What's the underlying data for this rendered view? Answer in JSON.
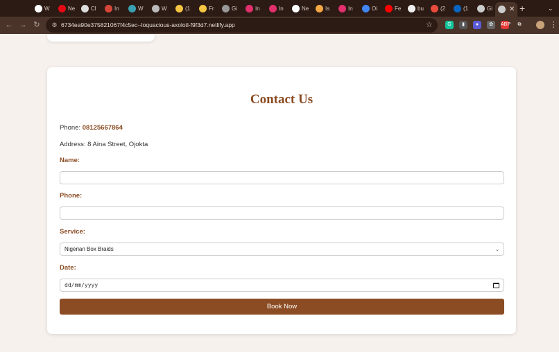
{
  "browser": {
    "tabs": [
      {
        "title": "W",
        "color": "#ffffff"
      },
      {
        "title": "Ne",
        "color": "#e50914"
      },
      {
        "title": "Cl",
        "color": "#dddddd"
      },
      {
        "title": "In",
        "color": "#d44638"
      },
      {
        "title": "W",
        "color": "#3aa0b3"
      },
      {
        "title": "W",
        "color": "#bbbbbb"
      },
      {
        "title": "(1",
        "color": "#f4c542"
      },
      {
        "title": "Fr",
        "color": "#f4c542"
      },
      {
        "title": "Gi",
        "color": "#999999"
      },
      {
        "title": "In",
        "color": "#e1306c"
      },
      {
        "title": "In",
        "color": "#e1306c"
      },
      {
        "title": "Ne",
        "color": "#ffffff"
      },
      {
        "title": "Is",
        "color": "#f4a742"
      },
      {
        "title": "In",
        "color": "#e1306c"
      },
      {
        "title": "Oi",
        "color": "#4285f4"
      },
      {
        "title": "Fe",
        "color": "#ff0000"
      },
      {
        "title": "bu",
        "color": "#eeeeee"
      },
      {
        "title": "(2",
        "color": "#e94c3c"
      },
      {
        "title": "(1",
        "color": "#0a66c2"
      },
      {
        "title": "Gi",
        "color": "#cccccc"
      }
    ],
    "active_tab_color": "#cccccc",
    "url": "6734ea90e375821067f4c5ec--loquacious-axolotl-f9f3d7.netlify.app",
    "extensions": [
      {
        "label": "G",
        "color": "#15c39a"
      },
      {
        "label": "▮",
        "color": "#555555"
      },
      {
        "label": "●",
        "color": "#5b5bd6"
      },
      {
        "label": "✿",
        "color": "#666666"
      },
      {
        "label": "ABP",
        "color": "#e53935"
      },
      {
        "label": "⧉",
        "color": "#4a342a"
      }
    ]
  },
  "contact": {
    "title": "Contact Us",
    "phone_prefix": "Phone: ",
    "phone_number": "08125667864",
    "address": "Address: 8 Aina Street, Ojokta",
    "name_label": "Name:",
    "name_value": "",
    "phone_label": "Phone:",
    "phone_value": "",
    "service_label": "Service:",
    "service_selected": "Nigerian Box Braids",
    "date_label": "Date:",
    "date_placeholder": "dd/mm/yyyy",
    "submit_label": "Book Now"
  },
  "colors": {
    "accent": "#8b4c23",
    "page_bg": "#f7f1ee"
  }
}
